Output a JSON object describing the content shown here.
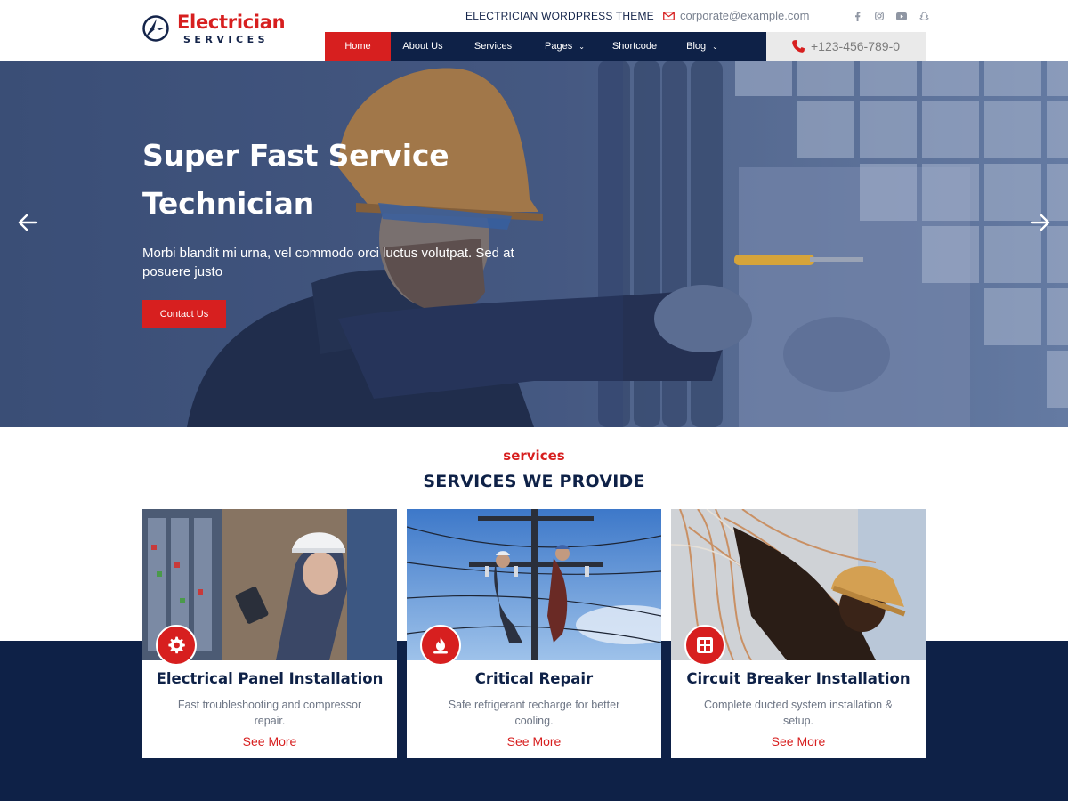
{
  "brand": {
    "title": "Electrician",
    "subtitle": "SERVICES"
  },
  "topbar": {
    "theme_text": "ELECTRICIAN WORDPRESS THEME",
    "email": "corporate@example.com",
    "socials": [
      "facebook-icon",
      "instagram-icon",
      "youtube-icon",
      "snapchat-icon"
    ]
  },
  "nav": {
    "items": [
      {
        "label": "Home",
        "active": true
      },
      {
        "label": "About Us"
      },
      {
        "label": "Services"
      },
      {
        "label": "Pages",
        "dropdown": true
      },
      {
        "label": "Shortcode"
      },
      {
        "label": "Blog",
        "dropdown": true
      }
    ],
    "phone": "+123-456-789-0"
  },
  "hero": {
    "title_line1": "Super Fast Service",
    "title_line2": "Technician",
    "description": "Morbi blandit mi urna, vel commodo orci luctus volutpat. Sed at posuere justo",
    "button": "Contact Us"
  },
  "services": {
    "subtitle": "services",
    "title": "SERVICES WE PROVIDE",
    "cards": [
      {
        "title": "Electrical Panel Installation",
        "desc": "Fast troubleshooting and compressor repair.",
        "more": "See More",
        "icon": "gear-icon"
      },
      {
        "title": "Critical Repair",
        "desc": "Safe refrigerant recharge for better cooling.",
        "more": "See More",
        "icon": "flame-icon"
      },
      {
        "title": "Circuit Breaker Installation",
        "desc": "Complete ducted system installation & setup.",
        "more": "See More",
        "icon": "grid-icon"
      }
    ]
  },
  "colors": {
    "accent": "#d71f1f",
    "navy": "#0e2147"
  }
}
